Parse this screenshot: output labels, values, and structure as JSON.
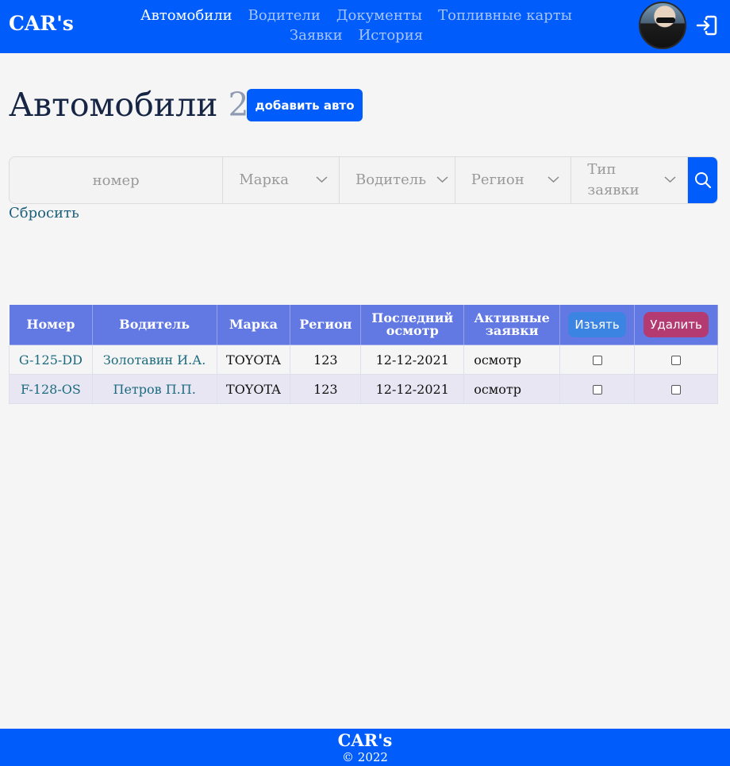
{
  "header": {
    "brand": "CAR's",
    "nav": [
      {
        "label": "Автомобили",
        "active": true
      },
      {
        "label": "Водители",
        "active": false
      },
      {
        "label": "Документы",
        "active": false
      },
      {
        "label": "Топливные карты",
        "active": false
      },
      {
        "label": "Заявки",
        "active": false
      },
      {
        "label": "История",
        "active": false
      }
    ],
    "avatar_icon": "user-avatar",
    "logout_icon": "logout-icon"
  },
  "page": {
    "title": "Автомобили",
    "count": "2",
    "add_button": "добавить авто"
  },
  "filters": {
    "number_placeholder": "номер",
    "brand": "Марка",
    "driver": "Водитель",
    "region": "Регион",
    "request_type": "Тип заявки",
    "search_icon": "search-icon",
    "reset": "Сбросить"
  },
  "table": {
    "headers": {
      "number": "Номер",
      "driver": "Водитель",
      "brand": "Марка",
      "region": "Регион",
      "last_inspection": "Последний осмотр",
      "active_requests": "Активные заявки",
      "seize_button": "Изъять",
      "delete_button": "Удалить"
    },
    "rows": [
      {
        "number": "G-125-DD",
        "driver": "Золотавин И.А.",
        "brand": "TOYOTA",
        "region": "123",
        "last_inspection": "12-12-2021",
        "active_requests": "осмотр",
        "seize": false,
        "delete": false
      },
      {
        "number": "F-128-OS",
        "driver": "Петров П.П.",
        "brand": "TOYOTA",
        "region": "123",
        "last_inspection": "12-12-2021",
        "active_requests": "осмотр",
        "seize": false,
        "delete": false
      }
    ]
  },
  "footer": {
    "brand": "CAR's",
    "copyright": "© 2022"
  },
  "colors": {
    "primary": "#005cfa",
    "table_header": "#6278e2",
    "seize_button": "#3c84e1",
    "delete_button": "#b43b72",
    "link": "#1c6b7f"
  }
}
